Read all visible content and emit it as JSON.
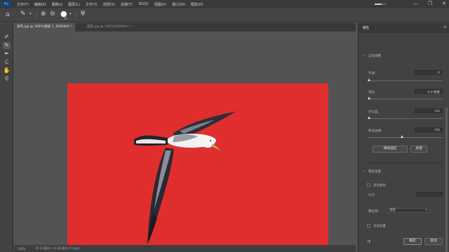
{
  "menubar": {
    "logo": "Ps",
    "items": [
      "文件(F)",
      "编辑(E)",
      "图像(I)",
      "图层(L)",
      "文字(Y)",
      "选择(S)",
      "滤镜(T)",
      "3D(D)",
      "视图(V)",
      "窗口(W)",
      "帮助(H)"
    ],
    "window_controls": [
      "—",
      "❐",
      "✕"
    ],
    "progress": 0.6
  },
  "options_bar": {
    "brush_size": "20"
  },
  "tabs": [
    {
      "label": "海鸟.jpg @ 100%(图层 1, RGB/8#) *",
      "active": true
    },
    {
      "label": "田田.jpg @ 100%(RGB/8#) *",
      "active": false
    }
  ],
  "status": {
    "zoom": "100%",
    "info": "19.33 厘米 x 14.28 厘米 (72 ppi)"
  },
  "panel": {
    "tab_label": "属性",
    "section_global": "全局调整",
    "smooth": {
      "label": "平滑:",
      "value": "0"
    },
    "feather": {
      "label": "羽化:",
      "value": "0.0 像素"
    },
    "contrast": {
      "label": "对比度:",
      "value": "0%"
    },
    "shift_edge": {
      "label": "移动边缘:",
      "value": "0%"
    },
    "clear_selection_label": "清除选区",
    "invert_label": "反相",
    "section_output": "输出设置",
    "decontaminate_label": "净化颜色",
    "amount_label": "数量:",
    "output_to_label": "输出到:",
    "output_to_value": "选区",
    "remember_label": "记住设置",
    "ok_label": "确定",
    "cancel_label": "取消"
  },
  "colors": {
    "canvas_red": "#e02e2e",
    "bird_white": "#f2f2f2",
    "bird_dark": "#2a2a32"
  }
}
